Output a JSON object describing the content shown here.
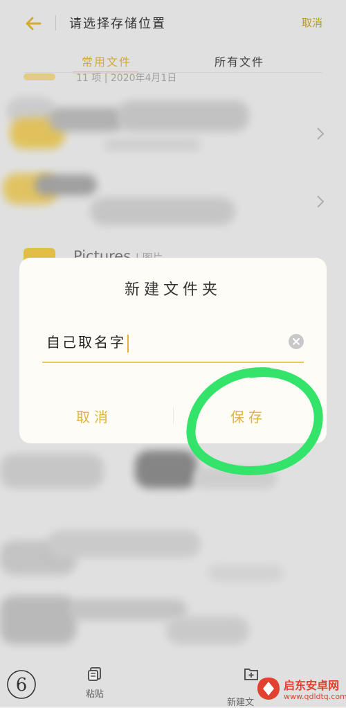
{
  "header": {
    "title": "请选择存储位置",
    "cancel_label": "取消"
  },
  "tabs": [
    {
      "label": "常用文件",
      "active": true
    },
    {
      "label": "所有文件",
      "active": false
    }
  ],
  "list": {
    "partial_meta": "11 项 | 2020年4月1日",
    "pictures_label": "Pictures",
    "pictures_meta": "| 图片"
  },
  "dialog": {
    "title": "新建文件夹",
    "input_value": "自己取名字",
    "cancel_label": "取消",
    "save_label": "保存"
  },
  "bottom": {
    "paste_label": "粘贴",
    "new_folder_label": "新建文"
  },
  "annotation": {
    "step_number": "6"
  },
  "watermark": {
    "name": "启东安卓网",
    "url": "www.qdldtq.com"
  },
  "colors": {
    "accent": "#e0b53a",
    "annotation_green": "#33e36a",
    "watermark_red": "#e2412f"
  }
}
